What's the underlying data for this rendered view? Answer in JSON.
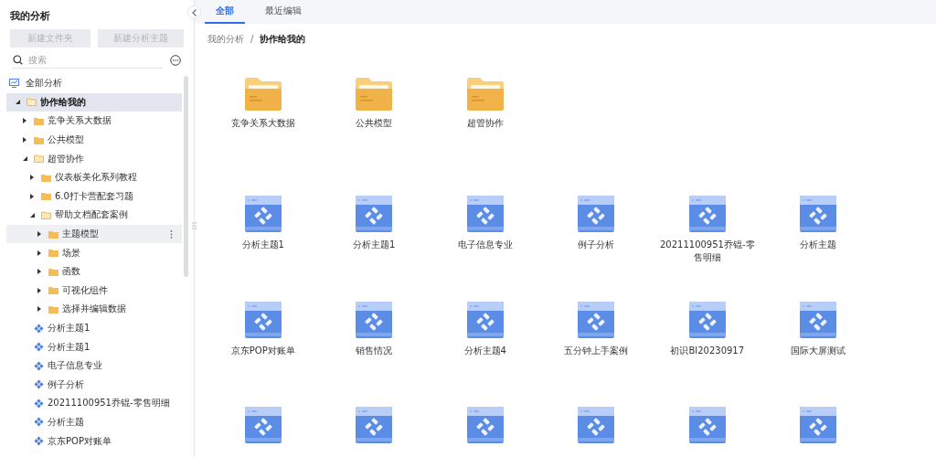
{
  "sidebar": {
    "title": "我的分析",
    "buttons": [
      {
        "label": "新建文件夹",
        "disabled": true
      },
      {
        "label": "新建分析主题",
        "disabled": true
      }
    ],
    "search": {
      "placeholder": "搜索"
    },
    "all_analysis": {
      "label": "全部分析"
    },
    "tree": [
      {
        "kind": "shared-folder",
        "label": "协作给我的",
        "expanded": true,
        "selected": true,
        "hovered": false,
        "children": [
          {
            "kind": "folder",
            "label": "竞争关系大数据",
            "expanded": false,
            "selected": false,
            "hovered": false
          },
          {
            "kind": "folder",
            "label": "公共模型",
            "expanded": false,
            "selected": false,
            "hovered": false
          },
          {
            "kind": "folder",
            "label": "超管协作",
            "expanded": true,
            "selected": false,
            "hovered": false,
            "children": [
              {
                "kind": "folder",
                "label": "仪表板美化系列教程",
                "expanded": false,
                "selected": false,
                "hovered": false
              },
              {
                "kind": "folder",
                "label": "6.0打卡营配套习题",
                "expanded": false,
                "selected": false,
                "hovered": false
              },
              {
                "kind": "folder",
                "label": "帮助文档配套案例",
                "expanded": true,
                "selected": false,
                "hovered": false,
                "children": [
                  {
                    "kind": "folder",
                    "label": "主题模型",
                    "expanded": false,
                    "selected": false,
                    "hovered": true
                  },
                  {
                    "kind": "folder",
                    "label": "场景",
                    "expanded": false,
                    "selected": false,
                    "hovered": false
                  },
                  {
                    "kind": "folder",
                    "label": "函数",
                    "expanded": false,
                    "selected": false,
                    "hovered": false
                  },
                  {
                    "kind": "folder",
                    "label": "可视化组件",
                    "expanded": false,
                    "selected": false,
                    "hovered": false
                  },
                  {
                    "kind": "folder",
                    "label": "选择并编辑数据",
                    "expanded": false,
                    "selected": false,
                    "hovered": false
                  }
                ]
              }
            ]
          },
          {
            "kind": "analysis",
            "label": "分析主题1",
            "selected": false,
            "hovered": false
          },
          {
            "kind": "analysis",
            "label": "分析主题1",
            "selected": false,
            "hovered": false
          },
          {
            "kind": "analysis",
            "label": "电子信息专业",
            "selected": false,
            "hovered": false
          },
          {
            "kind": "analysis",
            "label": "例子分析",
            "selected": false,
            "hovered": false
          },
          {
            "kind": "analysis",
            "label": "20211100951乔锟-零售明细",
            "selected": false,
            "hovered": false
          },
          {
            "kind": "analysis",
            "label": "分析主题",
            "selected": false,
            "hovered": false
          },
          {
            "kind": "analysis",
            "label": "京东POP对账单",
            "selected": false,
            "hovered": false
          }
        ]
      }
    ]
  },
  "tabs": [
    {
      "label": "全部",
      "selected": true
    },
    {
      "label": "最近编辑",
      "selected": false
    }
  ],
  "breadcrumb": {
    "items": [
      "我的分析",
      "协作给我的"
    ],
    "separator": "/"
  },
  "folders": [
    {
      "name": "竞争关系大数据"
    },
    {
      "name": "公共模型"
    },
    {
      "name": "超管协作"
    }
  ],
  "analyses": [
    {
      "kind": "analysis",
      "name": "分析主题1"
    },
    {
      "kind": "analysis",
      "name": "分析主题1"
    },
    {
      "kind": "analysis",
      "name": "电子信息专业"
    },
    {
      "kind": "analysis",
      "name": "例子分析"
    },
    {
      "kind": "analysis",
      "name": "20211100951乔锟-零售明细"
    },
    {
      "kind": "analysis",
      "name": "分析主题"
    },
    {
      "kind": "analysis",
      "name": "京东POP对账单"
    },
    {
      "kind": "analysis",
      "name": "销售情况"
    },
    {
      "kind": "analysis",
      "name": "分析主题4"
    },
    {
      "kind": "analysis",
      "name": "五分钟上手案例"
    },
    {
      "kind": "analysis",
      "name": "初识BI20230917"
    },
    {
      "kind": "analysis",
      "name": "国际大屏测试"
    },
    {
      "kind": "analysis"
    },
    {
      "kind": "analysis"
    },
    {
      "kind": "analysis"
    },
    {
      "kind": "analysis"
    },
    {
      "kind": "analysis"
    },
    {
      "kind": "analysis"
    }
  ]
}
